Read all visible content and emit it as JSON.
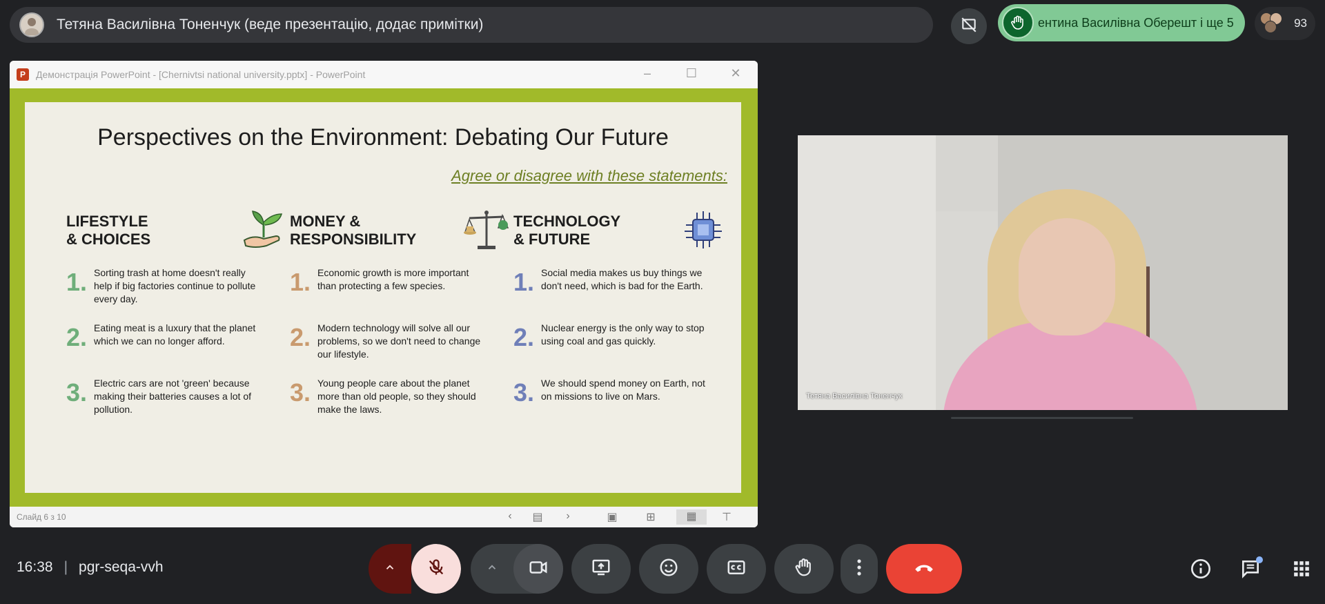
{
  "top_bar": {
    "presenter_text": "Тетяна Василівна Тоненчук (веде презентацію, додає примітки)",
    "raised_hand_text": "ентина Василівна Оберешт і ще 5",
    "participants_count": "93"
  },
  "ppt": {
    "window_title": "Демонстрація PowerPoint - [Chernivtsi national university.pptx] - PowerPoint",
    "slide_counter": "Слайд 6 з 10",
    "slide": {
      "title": "Perspectives on the Environment: Debating Our Future",
      "subtitle": "Agree or disagree with these statements:",
      "columns": [
        {
          "heading": "LIFESTYLE\n& CHOICES",
          "icon": "plant-hand-icon",
          "color": "#6fae7a",
          "statements": [
            {
              "num": "1.",
              "text": "Sorting trash at home doesn't really help if big factories continue to pollute every day."
            },
            {
              "num": "2.",
              "text": "Eating meat is a luxury that the planet which we can no longer afford."
            },
            {
              "num": "3.",
              "text": "Electric cars are not 'green' because making their batteries causes a lot of pollution."
            }
          ]
        },
        {
          "heading": "MONEY &\nRESPONSIBILITY",
          "icon": "scales-icon",
          "color": "#c99a6e",
          "statements": [
            {
              "num": "1.",
              "text": "Economic growth is more important than protecting a few species."
            },
            {
              "num": "2.",
              "text": "Modern technology will solve all our problems, so we don't need to change our lifestyle."
            },
            {
              "num": "3.",
              "text": "Young people care about the planet more than old people, so they should make the laws."
            }
          ]
        },
        {
          "heading": "TECHNOLOGY\n& FUTURE",
          "icon": "chip-icon",
          "color": "#6f7fb8",
          "statements": [
            {
              "num": "1.",
              "text": "Social media makes us buy things we don't need, which is bad for the Earth."
            },
            {
              "num": "2.",
              "text": "Nuclear energy is the only way to stop using coal and gas quickly."
            },
            {
              "num": "3.",
              "text": "We should spend money on Earth, not on missions to live on Mars."
            }
          ]
        }
      ]
    }
  },
  "video_tile": {
    "name": "Тетяна Василівна Тоненчук"
  },
  "bottom_bar": {
    "time": "16:38",
    "separator": "|",
    "meeting_code": "pgr-seqa-vvh"
  },
  "colors": {
    "background": "#202124",
    "end_call": "#ea4335",
    "slide_border": "#a1ba2a",
    "raised_hand": "#81c995",
    "mic_muted_bg": "#f9dedc"
  }
}
